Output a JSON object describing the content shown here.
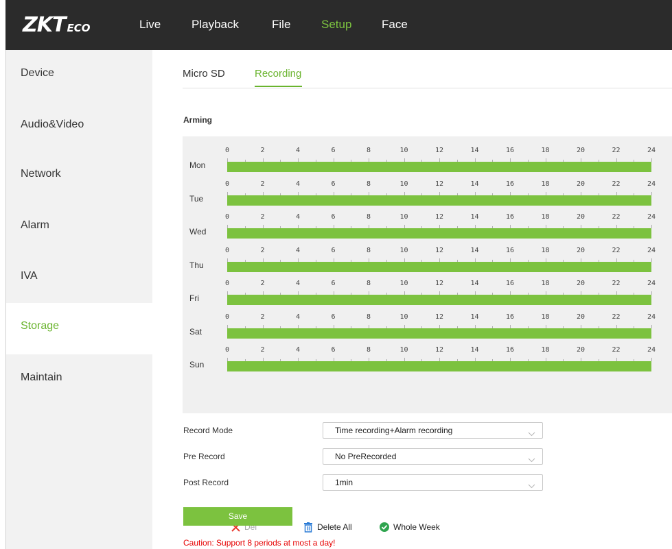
{
  "brand": {
    "zk": "ZK",
    "t": "T",
    "eco": "ECO"
  },
  "nav": [
    {
      "label": "Live",
      "active": false
    },
    {
      "label": "Playback",
      "active": false
    },
    {
      "label": "File",
      "active": false
    },
    {
      "label": "Setup",
      "active": true
    },
    {
      "label": "Face",
      "active": false
    }
  ],
  "sidebar": {
    "items": [
      {
        "label": "Device",
        "active": false
      },
      {
        "label": "Audio&Video",
        "active": false
      },
      {
        "label": "Network",
        "active": false
      },
      {
        "label": "Alarm",
        "active": false
      },
      {
        "label": "IVA",
        "active": false
      },
      {
        "label": "Storage",
        "active": true
      },
      {
        "label": "Maintain",
        "active": false
      }
    ]
  },
  "tabs": [
    {
      "label": "Micro SD",
      "active": false
    },
    {
      "label": "Recording",
      "active": true
    }
  ],
  "arming": {
    "title": "Arming",
    "hours": [
      "0",
      "2",
      "4",
      "6",
      "8",
      "10",
      "12",
      "14",
      "16",
      "18",
      "20",
      "22",
      "24"
    ],
    "days": [
      {
        "label": "Mon",
        "start": 0,
        "end": 24
      },
      {
        "label": "Tue",
        "start": 0,
        "end": 24
      },
      {
        "label": "Wed",
        "start": 0,
        "end": 24
      },
      {
        "label": "Thu",
        "start": 0,
        "end": 24
      },
      {
        "label": "Fri",
        "start": 0,
        "end": 24
      },
      {
        "label": "Sat",
        "start": 0,
        "end": 24
      },
      {
        "label": "Sun",
        "start": 0,
        "end": 24
      }
    ],
    "buttons": {
      "del": "Del",
      "delete_all": "Delete All",
      "whole_week": "Whole Week"
    }
  },
  "form": {
    "record_mode": {
      "label": "Record Mode",
      "value": "Time recording+Alarm recording"
    },
    "pre_record": {
      "label": "Pre Record",
      "value": "No PreRecorded"
    },
    "post_record": {
      "label": "Post Record",
      "value": "1min"
    }
  },
  "save_label": "Save",
  "caution": "Caution:  Support 8 periods at most a day!",
  "colors": {
    "accent": "#7cc23f",
    "accent_text": "#6ab42e",
    "topbar": "#2b2b2b",
    "caution": "#e60000"
  }
}
